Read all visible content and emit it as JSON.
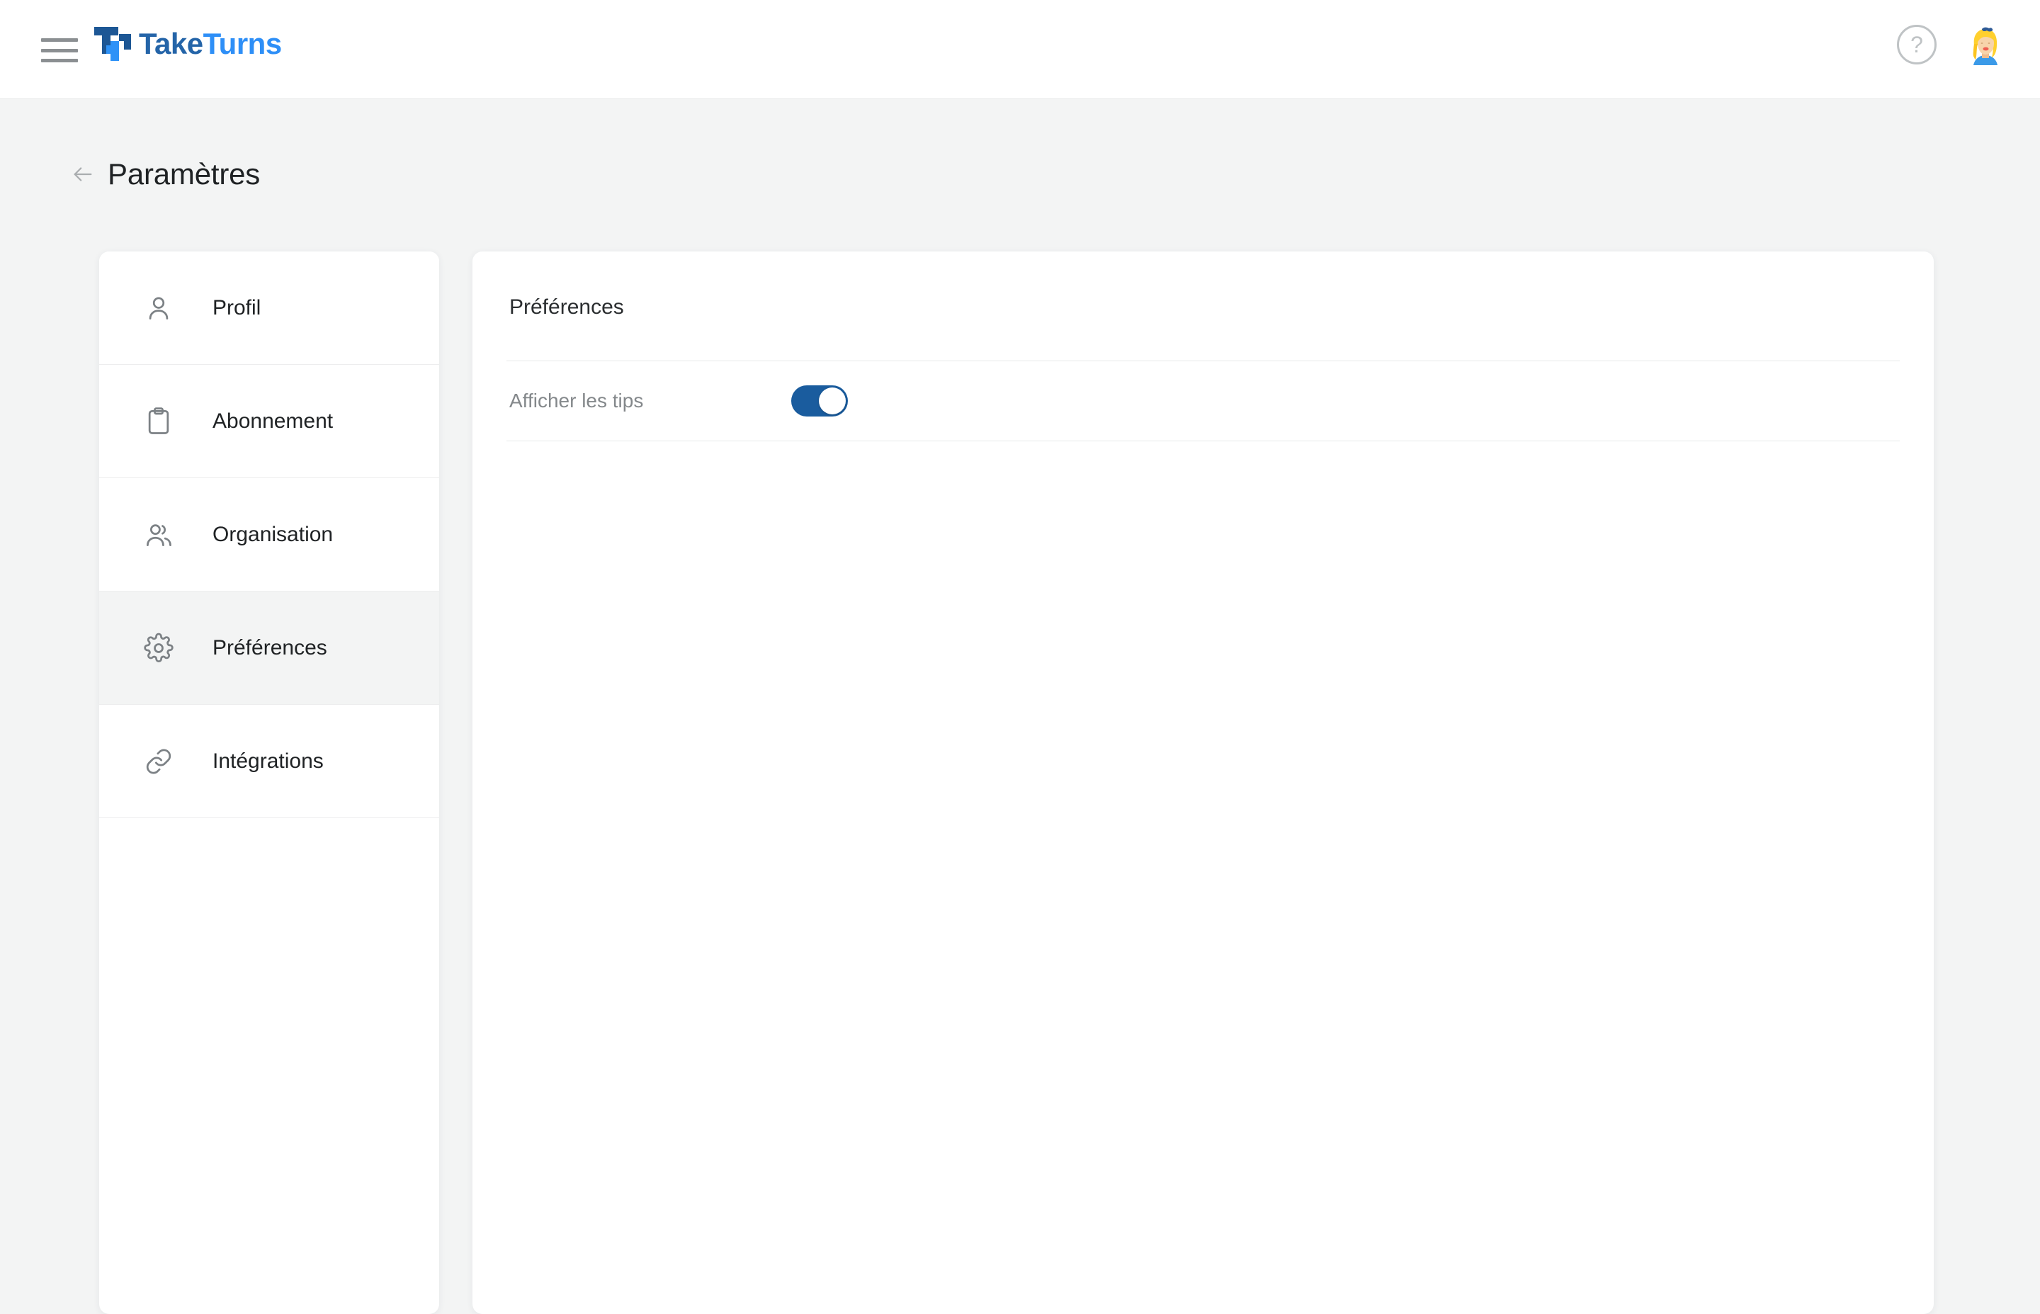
{
  "header": {
    "menu_icon": "hamburger-menu-icon",
    "logo": {
      "mark": "taketurns-logo-mark",
      "word_part1": "Take",
      "word_part2": "Turns",
      "color_dark": "#2464a8",
      "color_light": "#2e8ff7"
    },
    "help_icon_label": "?",
    "avatar_label": "user-avatar"
  },
  "page": {
    "back_icon": "arrow-left-icon",
    "title": "Paramètres",
    "background_color": "#f3f4f4"
  },
  "sidebar": {
    "items": [
      {
        "id": "profil",
        "label": "Profil",
        "icon": "user-icon",
        "active": false
      },
      {
        "id": "abonnement",
        "label": "Abonnement",
        "icon": "clipboard-icon",
        "active": false
      },
      {
        "id": "organisation",
        "label": "Organisation",
        "icon": "users-icon",
        "active": false
      },
      {
        "id": "preferences",
        "label": "Préférences",
        "icon": "gear-icon",
        "active": true
      },
      {
        "id": "integrations",
        "label": "Intégrations",
        "icon": "link-icon",
        "active": false
      }
    ]
  },
  "main": {
    "title": "Préférences",
    "rows": [
      {
        "id": "afficher-les-tips",
        "label": "Afficher les tips",
        "control": "toggle",
        "value": true,
        "accent_color": "#1a5c9e"
      }
    ]
  }
}
